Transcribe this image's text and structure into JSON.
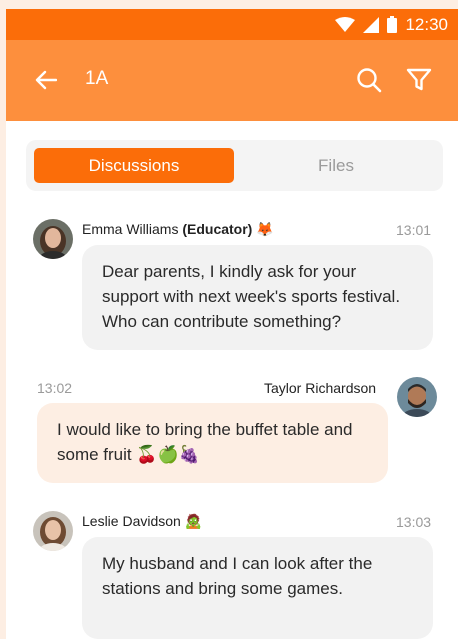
{
  "status_bar": {
    "time": "12:30"
  },
  "app_bar": {
    "title": "1A"
  },
  "tabs": [
    {
      "label": "Discussions",
      "active": true
    },
    {
      "label": "Files",
      "active": false
    }
  ],
  "messages": [
    {
      "author": "Emma Williams",
      "author_role": "(Educator)",
      "author_emoji": "🦊",
      "time": "13:01",
      "text": "Dear parents, I kindly ask for your support with next week's sports festival. Who can contribute something?"
    },
    {
      "author": "Taylor Richardson",
      "time": "13:02",
      "text": "I would like to bring the buffet table and some fruit 🍒🍏🍇"
    },
    {
      "author": "Leslie Davidson",
      "author_emoji": "🧟",
      "time": "13:03",
      "text": "My husband and I can look after the stations and bring some games."
    }
  ],
  "colors": {
    "status_bar": "#fb6d09",
    "app_bar": "#fd8f3d",
    "accent": "#fb6d09",
    "own_bubble": "#fdeee3",
    "other_bubble": "#f2f2f2"
  }
}
